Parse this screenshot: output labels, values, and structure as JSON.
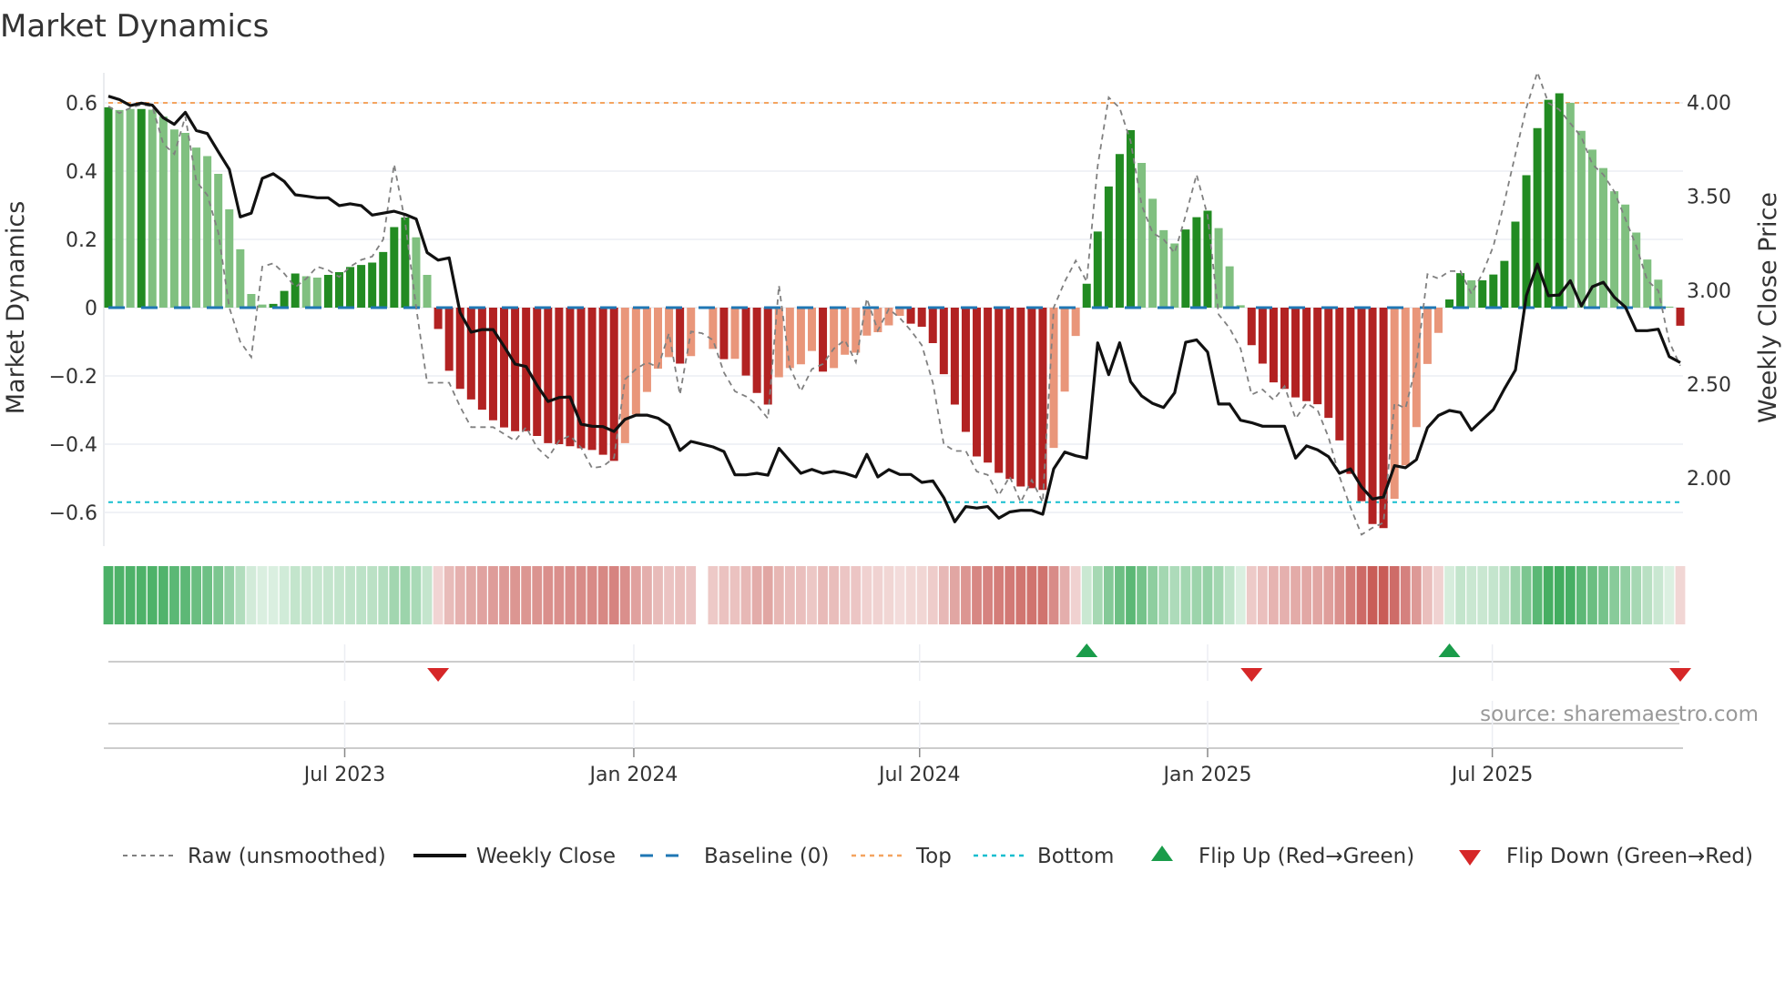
{
  "chart_data": {
    "type": "bar",
    "title": "Market Dynamics",
    "ylabel": "Market Dynamics",
    "y2label": "Weekly Close Price",
    "ylim": [
      -0.7,
      0.7
    ],
    "y2lim": [
      1.75,
      4.2
    ],
    "yticks": [
      0.6,
      0.4,
      0.2,
      0,
      -0.2,
      -0.4,
      -0.6
    ],
    "ytick_labels": [
      "0.6",
      "0.4",
      "0.2",
      "0",
      "−0.2",
      "−0.4",
      "−0.6"
    ],
    "y2ticks": [
      4.0,
      3.5,
      3.0,
      2.5,
      2.0
    ],
    "y2tick_labels": [
      "4.00",
      "3.50",
      "3.00",
      "2.50",
      "2.00"
    ],
    "xtick_labels": [
      "Jul 2023",
      "Jan 2024",
      "Jul 2024",
      "Jan 2025",
      "Jul 2025"
    ],
    "xtick_week_index": [
      21.5,
      47.8,
      73.8,
      100,
      125.9
    ],
    "frequency": "weekly",
    "top_level": 0.6,
    "bottom_level": -0.57,
    "baseline": 0,
    "momentum": [
      0.587,
      0.579,
      0.582,
      0.582,
      0.58,
      0.56,
      0.522,
      0.512,
      0.469,
      0.444,
      0.392,
      0.288,
      0.171,
      0.04,
      0.009,
      0.011,
      0.049,
      0.1,
      0.092,
      0.088,
      0.096,
      0.104,
      0.119,
      0.125,
      0.132,
      0.163,
      0.236,
      0.264,
      0.206,
      0.096,
      -0.0625,
      -0.185,
      -0.238,
      -0.269,
      -0.299,
      -0.33,
      -0.351,
      -0.362,
      -0.362,
      -0.376,
      -0.397,
      -0.4,
      -0.406,
      -0.412,
      -0.417,
      -0.431,
      -0.449,
      -0.397,
      -0.313,
      -0.247,
      -0.179,
      -0.145,
      -0.164,
      -0.142,
      null,
      -0.121,
      -0.151,
      -0.15,
      -0.199,
      -0.25,
      -0.284,
      -0.204,
      -0.177,
      -0.166,
      -0.127,
      -0.1875,
      -0.177,
      -0.138,
      -0.132,
      -0.082,
      -0.072,
      -0.052,
      -0.024,
      -0.047,
      -0.056,
      -0.104,
      -0.195,
      -0.284,
      -0.364,
      -0.436,
      -0.454,
      -0.484,
      -0.502,
      -0.524,
      -0.529,
      -0.534,
      -0.411,
      -0.246,
      -0.083,
      0.07,
      0.223,
      0.355,
      0.45,
      0.52,
      0.424,
      0.319,
      0.227,
      0.188,
      0.229,
      0.265,
      0.284,
      0.233,
      0.121,
      0.007,
      -0.11,
      -0.164,
      -0.219,
      -0.238,
      -0.263,
      -0.274,
      -0.283,
      -0.323,
      -0.389,
      -0.487,
      -0.567,
      -0.634,
      -0.646,
      -0.56,
      -0.462,
      -0.35,
      -0.165,
      -0.074,
      0.024,
      0.101,
      0.08,
      0.08,
      0.097,
      0.137,
      0.252,
      0.388,
      0.526,
      0.609,
      0.628,
      0.6,
      0.518,
      0.463,
      0.409,
      0.341,
      0.302,
      0.22,
      0.141,
      0.082,
      0.003,
      -0.053
    ],
    "shade": "GggGgggggggggggGGGggGGGGGGGGggRRRRRRRRRRRRRRRRRrrrrrRr-rRrRRRrrrrRrrrrrrrRRRRRRRRRRRRRrrrGGGGGggggGGGgggRRRRRRRRRRRRRrrrrrGGgGGGGGGGGggggggggggR",
    "shade_legend": {
      "G": "green strengthening",
      "g": "green weakening",
      "R": "red strengthening",
      "r": "red weakening"
    },
    "raw": [
      0.59,
      0.57,
      0.585,
      0.595,
      0.59,
      0.48,
      0.45,
      0.56,
      0.37,
      0.33,
      0.22,
      0.0,
      -0.1,
      -0.145,
      0.12,
      0.13,
      0.1,
      0.06,
      0.085,
      0.12,
      0.11,
      0.09,
      0.12,
      0.14,
      0.15,
      0.2,
      0.42,
      0.25,
      0.0,
      -0.22,
      -0.22,
      -0.22,
      -0.29,
      -0.35,
      -0.35,
      -0.35,
      -0.37,
      -0.39,
      -0.35,
      -0.41,
      -0.44,
      -0.39,
      -0.375,
      -0.41,
      -0.47,
      -0.465,
      -0.44,
      -0.21,
      -0.18,
      -0.16,
      -0.175,
      -0.075,
      -0.255,
      -0.07,
      -0.075,
      -0.095,
      -0.19,
      -0.245,
      -0.26,
      -0.285,
      -0.325,
      0.065,
      -0.175,
      -0.245,
      -0.18,
      -0.165,
      -0.12,
      -0.095,
      -0.16,
      0.027,
      -0.067,
      -0.004,
      -0.03,
      -0.067,
      -0.11,
      -0.22,
      -0.4,
      -0.42,
      -0.42,
      -0.48,
      -0.49,
      -0.55,
      -0.495,
      -0.57,
      -0.505,
      -0.57,
      0.0,
      0.076,
      0.138,
      0.076,
      0.415,
      0.616,
      0.585,
      0.487,
      0.3,
      0.219,
      0.2,
      0.16,
      0.27,
      0.39,
      0.27,
      -0.02,
      -0.06,
      -0.12,
      -0.255,
      -0.24,
      -0.27,
      -0.23,
      -0.325,
      -0.28,
      -0.3,
      -0.38,
      -0.495,
      -0.585,
      -0.665,
      -0.645,
      -0.63,
      -0.28,
      -0.295,
      -0.165,
      0.098,
      0.085,
      0.107,
      0.107,
      0.04,
      0.1,
      0.18,
      0.31,
      0.45,
      0.585,
      0.69,
      0.6,
      0.58,
      0.54,
      0.5,
      0.42,
      0.39,
      0.34,
      0.26,
      0.18,
      0.08,
      0.05,
      -0.1,
      -0.17
    ],
    "close": [
      4.033,
      4.015,
      3.983,
      3.996,
      3.985,
      3.918,
      3.883,
      3.947,
      3.85,
      3.834,
      3.737,
      3.643,
      3.39,
      3.41,
      3.595,
      3.62,
      3.579,
      3.508,
      3.5,
      3.492,
      3.492,
      3.45,
      3.46,
      3.45,
      3.4,
      3.41,
      3.42,
      3.403,
      3.379,
      3.2,
      3.16,
      3.172,
      2.88,
      2.776,
      2.79,
      2.79,
      2.7,
      2.606,
      2.593,
      2.493,
      2.407,
      2.428,
      2.431,
      2.286,
      2.275,
      2.273,
      2.247,
      2.312,
      2.334,
      2.334,
      2.318,
      2.28,
      2.146,
      2.194,
      2.18,
      2.165,
      2.14,
      2.016,
      2.016,
      2.024,
      2.014,
      2.157,
      2.09,
      2.024,
      2.045,
      2.024,
      2.035,
      2.024,
      2.005,
      2.125,
      2.005,
      2.044,
      2.018,
      2.018,
      1.976,
      1.984,
      1.895,
      1.766,
      1.847,
      1.839,
      1.847,
      1.785,
      1.818,
      1.827,
      1.827,
      1.806,
      2.048,
      2.137,
      2.118,
      2.105,
      2.719,
      2.55,
      2.719,
      2.512,
      2.436,
      2.396,
      2.375,
      2.453,
      2.722,
      2.735,
      2.67,
      2.393,
      2.393,
      2.307,
      2.294,
      2.275,
      2.275,
      2.275,
      2.105,
      2.17,
      2.149,
      2.113,
      2.024,
      2.048,
      1.952,
      1.887,
      1.898,
      2.065,
      2.054,
      2.097,
      2.267,
      2.332,
      2.359,
      2.348,
      2.254,
      2.31,
      2.364,
      2.474,
      2.574,
      2.97,
      3.139,
      2.97,
      2.974,
      3.05,
      2.916,
      3.018,
      3.042,
      2.962,
      2.91,
      2.784,
      2.784,
      2.792,
      2.646,
      2.614
    ],
    "flips": [
      {
        "index": 30,
        "type": "down"
      },
      {
        "index": 89,
        "type": "up"
      },
      {
        "index": 104,
        "type": "down"
      },
      {
        "index": 122,
        "type": "up"
      },
      {
        "index": 143,
        "type": "down"
      }
    ],
    "legend": {
      "placement": "bottom",
      "raw": "Raw (unsmoothed)",
      "close": "Weekly Close",
      "baseline": "Baseline (0)",
      "top": "Top",
      "bottom": "Bottom",
      "flip_up": "Flip Up (Red→Green)",
      "flip_down": "Flip Down (Green→Red)"
    },
    "colors": {
      "green_strong": "#228b22",
      "green_weak": "#80c080",
      "red_strong": "#b22222",
      "red_weak": "#e9967a",
      "raw": "#808080",
      "close": "#111111",
      "baseline": "#1f77b4",
      "top": "#f4a460",
      "bottom": "#17becf",
      "flip_up": "#1a9c4a",
      "flip_down": "#d62728",
      "strip_green": "#3caa5a",
      "strip_red": "#c85a55"
    },
    "source": "source: sharemaestro.com"
  }
}
